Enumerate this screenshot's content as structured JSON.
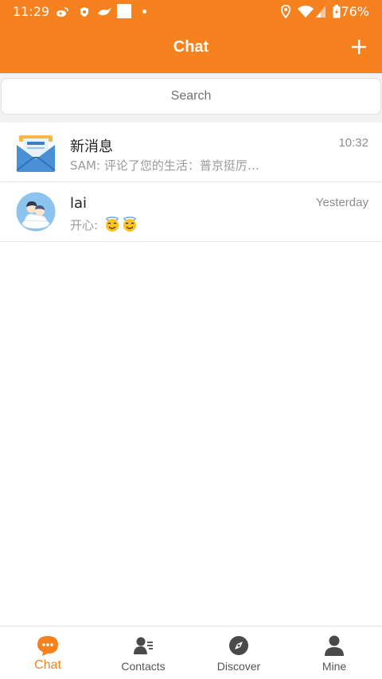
{
  "status_bar": {
    "time": "11:29",
    "battery": "76%",
    "icons": [
      "weibo-icon",
      "shield-icon",
      "bird-icon",
      "square-icon",
      "dot-icon",
      "location-icon",
      "wifi-icon",
      "signal-icon",
      "battery-icon"
    ]
  },
  "header": {
    "title": "Chat",
    "add_icon": "plus-icon"
  },
  "search": {
    "placeholder": "Search"
  },
  "chats": [
    {
      "name": "新消息",
      "time": "10:32",
      "preview": "SAM: 评论了您的生活：普京挺厉…",
      "avatar": "mail-envelope-icon"
    },
    {
      "name": "lai",
      "time": "Yesterday",
      "preview": "开心:",
      "avatar": "couple-avatar",
      "emojis": [
        "smiling-face-with-halo",
        "smiling-face-with-halo"
      ]
    }
  ],
  "nav": {
    "items": [
      {
        "label": "Chat",
        "icon": "chat-bubble-icon",
        "active": true
      },
      {
        "label": "Contacts",
        "icon": "contacts-icon",
        "active": false
      },
      {
        "label": "Discover",
        "icon": "compass-icon",
        "active": false
      },
      {
        "label": "Mine",
        "icon": "person-icon",
        "active": false
      }
    ]
  },
  "colors": {
    "accent": "#f5821f",
    "background": "#ffffff",
    "search_bg": "#f2f2f2",
    "muted_text": "#9a9a9a"
  }
}
